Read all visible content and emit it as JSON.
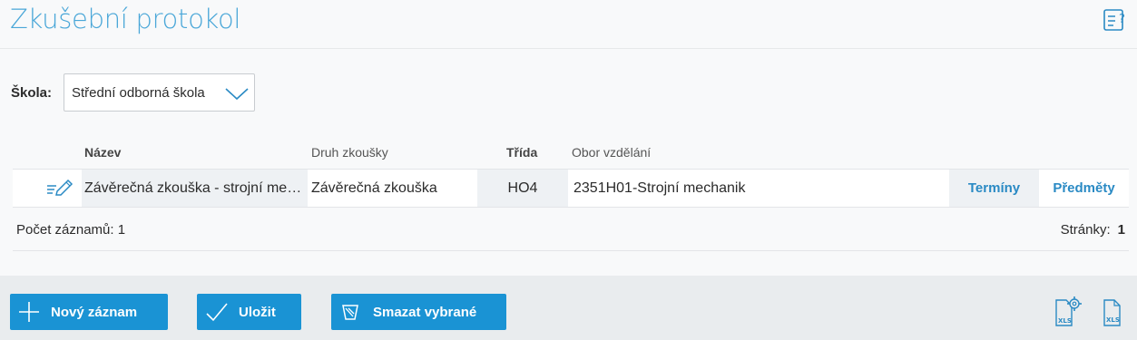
{
  "header": {
    "title": "Zkušební protokol"
  },
  "filter": {
    "label": "Škola:",
    "selected": "Střední odborná škola"
  },
  "table": {
    "columns": {
      "name": "Název",
      "exam_type": "Druh zkoušky",
      "class": "Třída",
      "field": "Obor vzdělání"
    },
    "rows": [
      {
        "name": "Závěrečná zkouška - strojní me…",
        "exam_type": "Závěrečná zkouška",
        "class": "HO4",
        "field": "2351H01-Strojní mechanik",
        "terms_link": "Termíny",
        "subjects_link": "Předměty"
      }
    ],
    "record_count": "Počet záznamů: 1",
    "pages_label": "Stránky:",
    "current_page": "1"
  },
  "toolbar": {
    "new_record": "Nový záznam",
    "save": "Uložit",
    "delete_selected": "Smazat vybrané"
  },
  "icons": {
    "help": "help-document-icon",
    "edit": "pencil-edit-icon",
    "chevron": "chevron-down-icon",
    "plus": "plus-icon",
    "check": "checkmark-icon",
    "trash": "trash-icon",
    "xls_settings": "xls-settings-icon",
    "xls": "xls-file-icon"
  },
  "colors": {
    "accent": "#1a93d4",
    "title": "#4aa7d8",
    "link": "#2a8ac4"
  }
}
